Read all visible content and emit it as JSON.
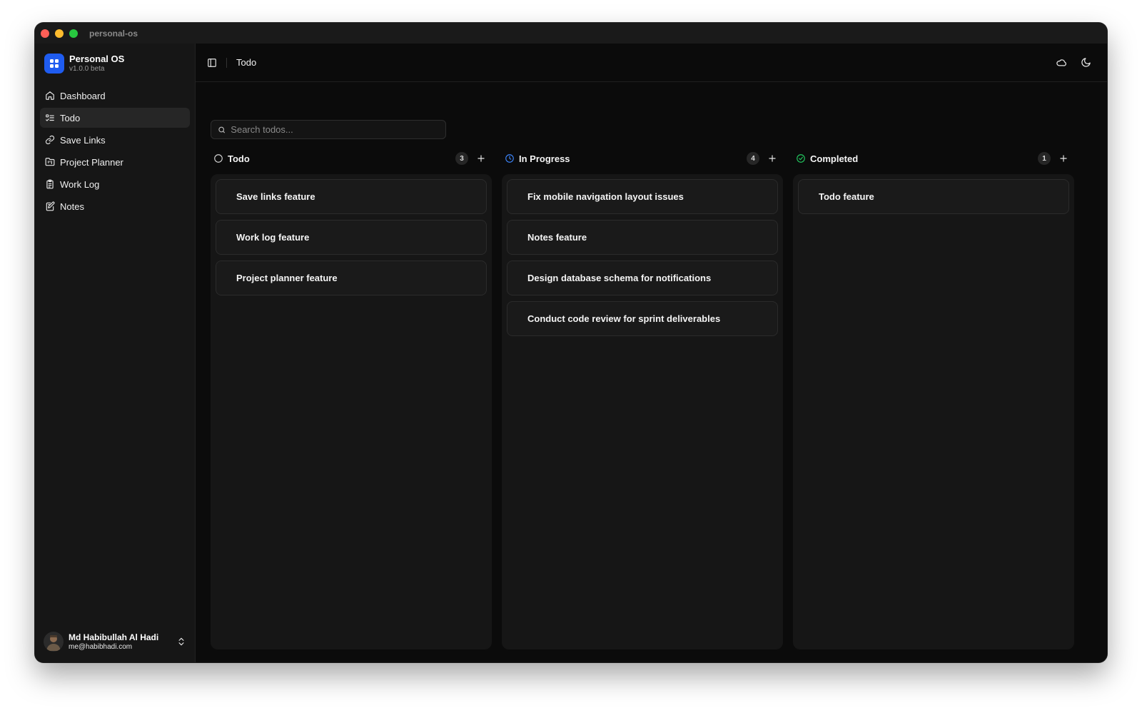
{
  "window": {
    "title": "personal-os"
  },
  "brand": {
    "name": "Personal OS",
    "version": "v1.0.0 beta"
  },
  "sidebar": {
    "items": [
      {
        "label": "Dashboard",
        "icon": "home-icon",
        "active": false
      },
      {
        "label": "Todo",
        "icon": "list-todo-icon",
        "active": true
      },
      {
        "label": "Save Links",
        "icon": "link-icon",
        "active": false
      },
      {
        "label": "Project Planner",
        "icon": "folder-kanban-icon",
        "active": false
      },
      {
        "label": "Work Log",
        "icon": "clipboard-icon",
        "active": false
      },
      {
        "label": "Notes",
        "icon": "edit-note-icon",
        "active": false
      }
    ]
  },
  "user": {
    "name": "Md Habibullah Al Hadi",
    "email": "me@habibhadi.com"
  },
  "topbar": {
    "breadcrumb": "Todo"
  },
  "search": {
    "placeholder": "Search todos...",
    "value": ""
  },
  "colors": {
    "accent": "#1f5cf0",
    "in_progress": "#3b82f6",
    "completed": "#22c55e"
  },
  "board": {
    "columns": [
      {
        "title": "Todo",
        "count": "3",
        "status_icon": "circle-icon",
        "cards": [
          "Save links feature",
          "Work log feature",
          "Project planner feature"
        ]
      },
      {
        "title": "In Progress",
        "count": "4",
        "status_icon": "clock-icon",
        "cards": [
          "Fix mobile navigation layout issues",
          "Notes feature",
          "Design database schema for notifications",
          "Conduct code review for sprint deliverables"
        ]
      },
      {
        "title": "Completed",
        "count": "1",
        "status_icon": "check-circle-icon",
        "cards": [
          "Todo feature"
        ]
      }
    ]
  }
}
